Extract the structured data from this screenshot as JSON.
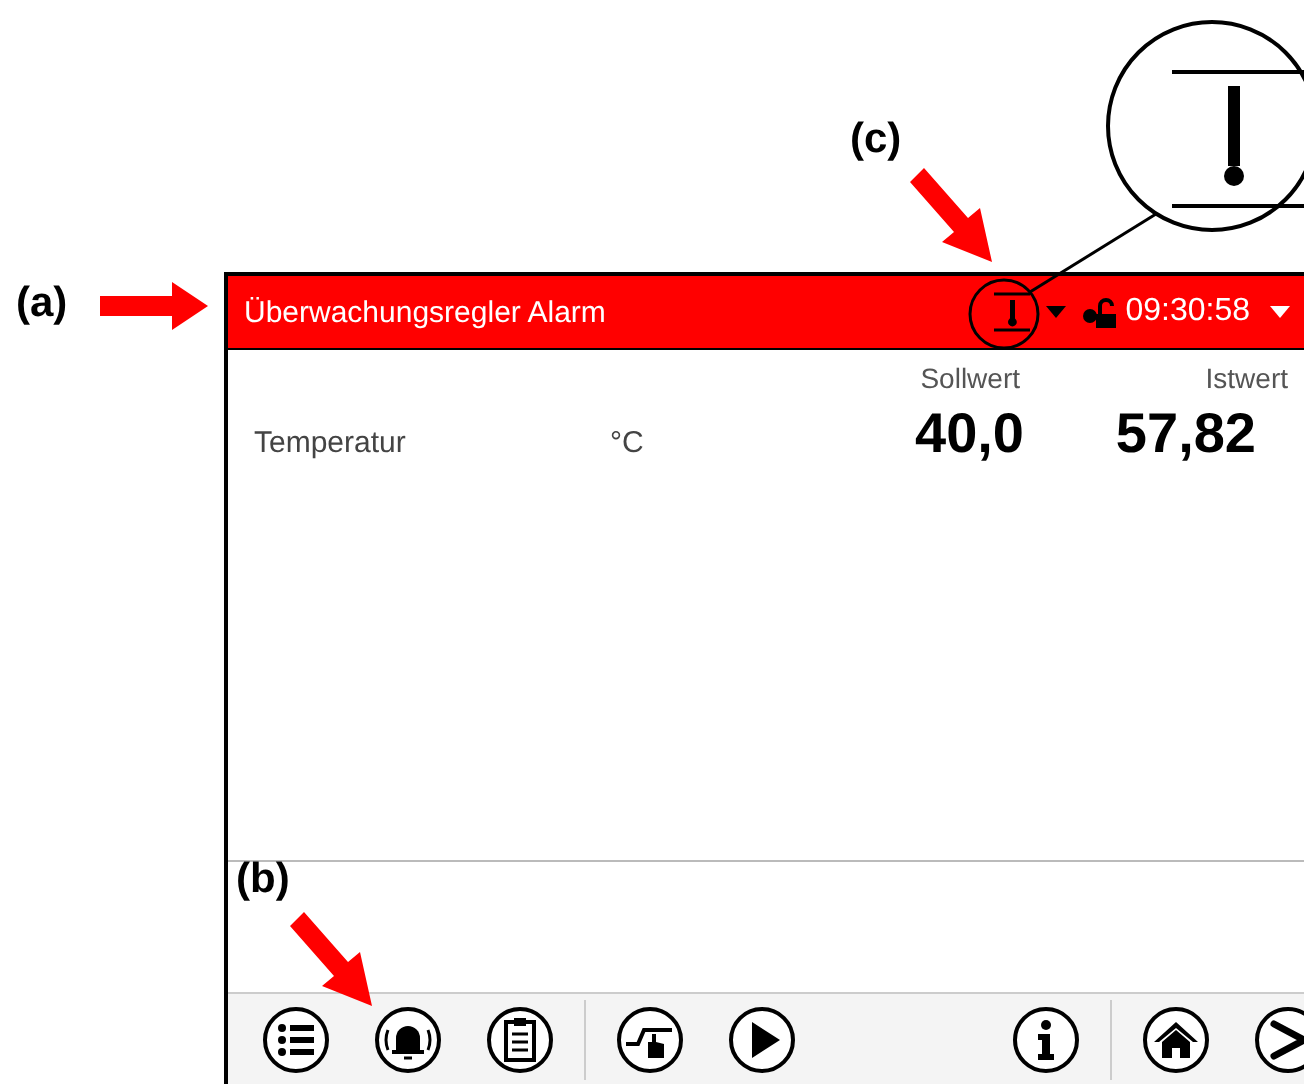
{
  "callouts": [
    {
      "label": "(a)"
    },
    {
      "label": "(c)"
    },
    {
      "label": "(b)"
    }
  ],
  "header": {
    "title": "Überwachungsregler Alarm",
    "time": "09:30:58",
    "alarm": true
  },
  "columns": [
    "Sollwert",
    "Istwert"
  ],
  "rows": [
    {
      "name": "Temperatur",
      "unit": "°C",
      "setpoint": "40,0",
      "actual": "57,82"
    }
  ],
  "toolbar": [
    [
      {
        "kind": "menu"
      },
      {
        "kind": "alarm"
      },
      {
        "kind": "notes"
      }
    ],
    [
      {
        "kind": "program"
      },
      {
        "kind": "play"
      }
    ],
    [
      {
        "kind": "info"
      }
    ],
    [
      {
        "kind": "home"
      },
      {
        "kind": "next"
      }
    ]
  ]
}
